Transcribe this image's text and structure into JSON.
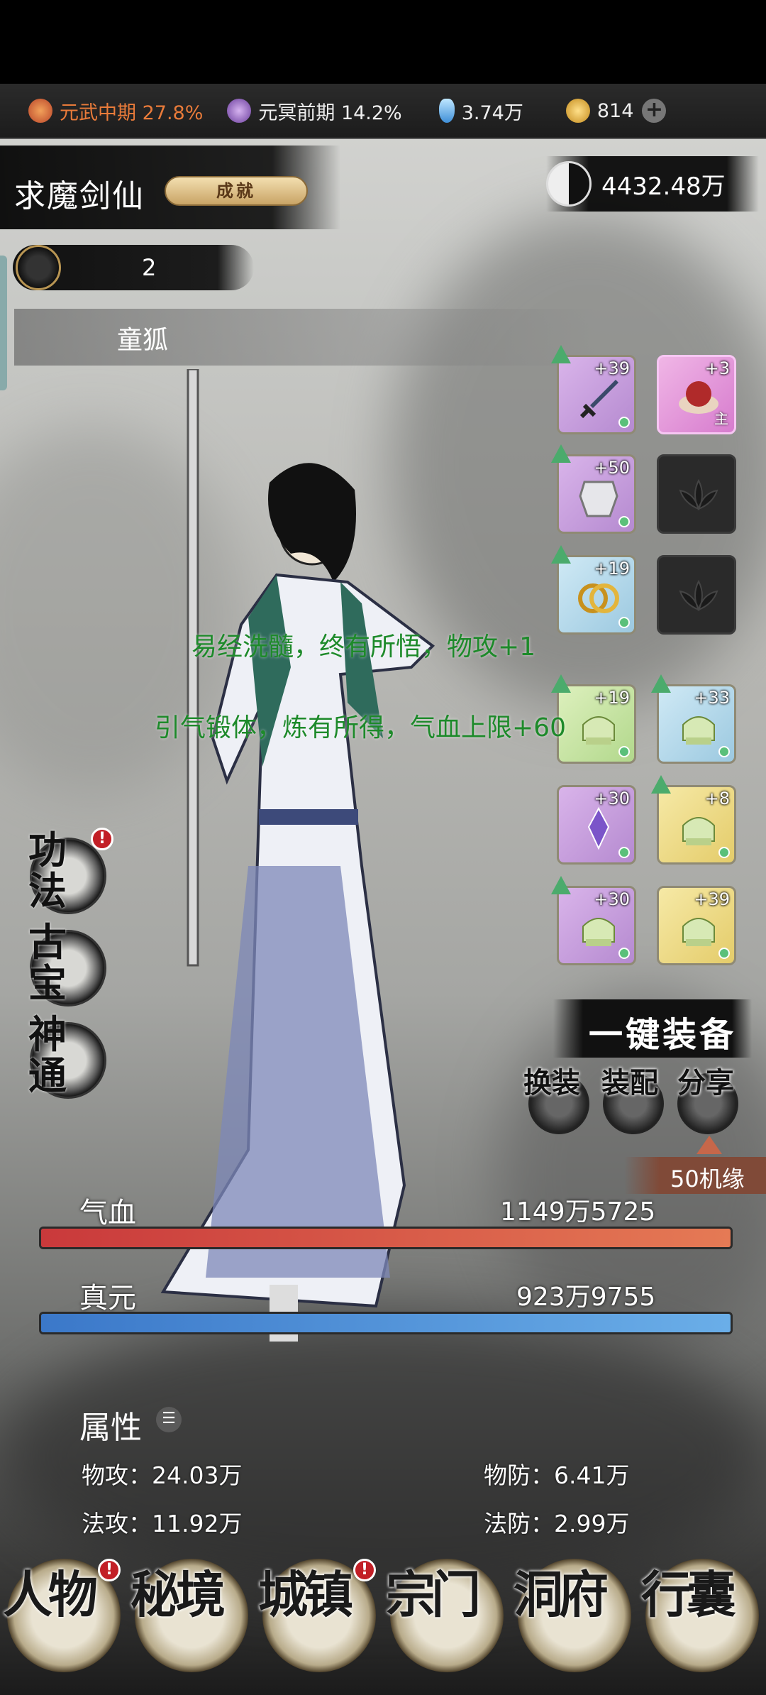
{
  "resources": {
    "realm1": {
      "label": "元武中期 27.8%",
      "color": "#e97b3a",
      "icon": "realm-fire-icon"
    },
    "realm2": {
      "label": "元冥前期 14.2%",
      "color": "#ffffff",
      "icon": "realm-purple-icon"
    },
    "spirit_stone": {
      "label": "3.74万",
      "icon": "crystal-icon"
    },
    "gold": {
      "label": "814",
      "icon": "coin-icon"
    },
    "add": "+"
  },
  "character": {
    "name": "求魔剑仙",
    "achievement_label": "成就",
    "power": "4432.48万",
    "level": "2",
    "pet_name": "童狐"
  },
  "equipment": [
    {
      "level": "+39",
      "rarity": "purple",
      "icon": "sword-icon",
      "upgradable": true
    },
    {
      "level": "+3",
      "rarity": "pink",
      "icon": "pet-egg-icon",
      "upgradable": false,
      "main_label": "主"
    },
    {
      "level": "+50",
      "rarity": "purple",
      "icon": "armor-icon",
      "upgradable": true
    },
    {
      "level": "",
      "rarity": "empty",
      "icon": "lotus-lock-icon",
      "upgradable": false
    },
    {
      "level": "+19",
      "rarity": "blue",
      "icon": "rings-icon",
      "upgradable": true
    },
    {
      "level": "",
      "rarity": "empty",
      "icon": "lotus-lock-icon",
      "upgradable": false
    },
    {
      "level": "+19",
      "rarity": "green",
      "icon": "jade-seal-icon",
      "upgradable": true
    },
    {
      "level": "+33",
      "rarity": "blue",
      "icon": "jade-seal-icon",
      "upgradable": true
    },
    {
      "level": "+30",
      "rarity": "purple",
      "icon": "talisman-icon",
      "upgradable": false
    },
    {
      "level": "+8",
      "rarity": "gold",
      "icon": "jade-seal-icon",
      "upgradable": true
    },
    {
      "level": "+30",
      "rarity": "purple",
      "icon": "jade-seal-icon",
      "upgradable": true
    },
    {
      "level": "+39",
      "rarity": "gold",
      "icon": "jade-seal-icon",
      "upgradable": false
    }
  ],
  "messages": [
    "易经洗髓，终有所悟，物攻+1",
    "引气锻体，炼有所得，气血上限+60"
  ],
  "side_menu": {
    "gongfa": "功法",
    "guobao": "古宝",
    "shentong": "神通"
  },
  "actions": {
    "one_key": "一键装备",
    "huan": "换装",
    "pei": "装配",
    "fen": "分享",
    "chance": "50机缘"
  },
  "bars": {
    "hp": {
      "label": "气血",
      "value": "1149万5725",
      "fill": 1.0,
      "color": "#c9393b"
    },
    "mp": {
      "label": "真元",
      "value": "923万9755",
      "fill": 1.0,
      "color": "#3b78c9"
    }
  },
  "attributes": {
    "title": "属性",
    "patk": "物攻：24.03万",
    "pdef": "物防：6.41万",
    "matk": "法攻：11.92万",
    "mdef": "法防：2.99万"
  },
  "nav": [
    "人物",
    "秘境",
    "城镇",
    "宗门",
    "洞府",
    "行囊"
  ],
  "badge": "!"
}
